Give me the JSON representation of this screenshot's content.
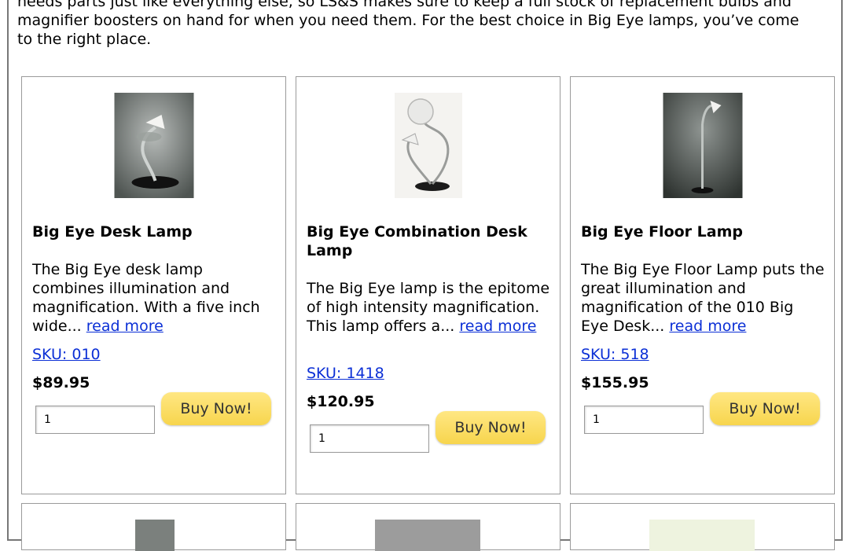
{
  "intro": {
    "line1": "needs parts just like everything else, so LS&S makes sure to keep a full stock of replacement bulbs and",
    "line2": "magnifier boosters on hand for when you need them. For the best choice in Big Eye lamps, you’ve come",
    "line3": "to the right place."
  },
  "products": [
    {
      "name": "Big Eye Desk Lamp",
      "description": "The Big Eye desk lamp combines illumination and magnification. With a five inch wide...",
      "read_more": "read more",
      "sku": "SKU: 010",
      "price": "$89.95",
      "quantity": "1",
      "buy_label": "Buy Now!"
    },
    {
      "name": "Big Eye Combination Desk Lamp",
      "description": "The Big Eye lamp is the epitome of high intensity magnification. This lamp offers a...",
      "read_more": "read more",
      "sku": "SKU: 1418",
      "price": "$120.95",
      "quantity": "1",
      "buy_label": "Buy Now!"
    },
    {
      "name": "Big Eye Floor Lamp",
      "description": "The Big Eye Floor Lamp puts the great illumination and magnification of the 010 Big Eye Desk...",
      "read_more": "read more",
      "sku": "SKU: 518",
      "price": "$155.95",
      "quantity": "1",
      "buy_label": "Buy Now!"
    }
  ],
  "colors": {
    "link": "#0b2fd6",
    "buy_button": "#f7d54d",
    "card_border": "#9a9a9a"
  }
}
